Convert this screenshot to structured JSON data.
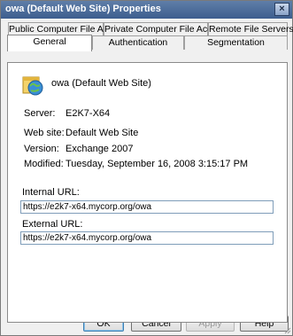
{
  "window": {
    "title": "owa (Default Web Site) Properties",
    "close_glyph": "×"
  },
  "tabs": {
    "row1": [
      {
        "label": "Public Computer File Access"
      },
      {
        "label": "Private Computer File Access"
      },
      {
        "label": "Remote File Servers"
      }
    ],
    "row2": [
      {
        "label": "General",
        "active": true
      },
      {
        "label": "Authentication"
      },
      {
        "label": "Segmentation"
      }
    ]
  },
  "general": {
    "site_name": "owa (Default Web Site)",
    "icon": "web-site-icon",
    "fields": [
      {
        "label": "Server:",
        "value": "E2K7-X64"
      },
      {
        "label": "Web site:",
        "value": "Default Web Site"
      },
      {
        "label": "Version:",
        "value": "Exchange 2007"
      },
      {
        "label": "Modified:",
        "value": "Tuesday, September 16, 2008 3:15:17 PM"
      }
    ],
    "internal_url": {
      "label": "Internal URL:",
      "value": "https://e2k7-x64.mycorp.org/owa"
    },
    "external_url": {
      "label": "External URL:",
      "value": "https://e2k7-x64.mycorp.org/owa"
    }
  },
  "buttons": {
    "ok": "OK",
    "cancel": "Cancel",
    "apply": "Apply",
    "help": "Help"
  },
  "colors": {
    "titlebar": "#4a6a9a",
    "panel": "#ffffff",
    "client": "#f0f0f0"
  }
}
